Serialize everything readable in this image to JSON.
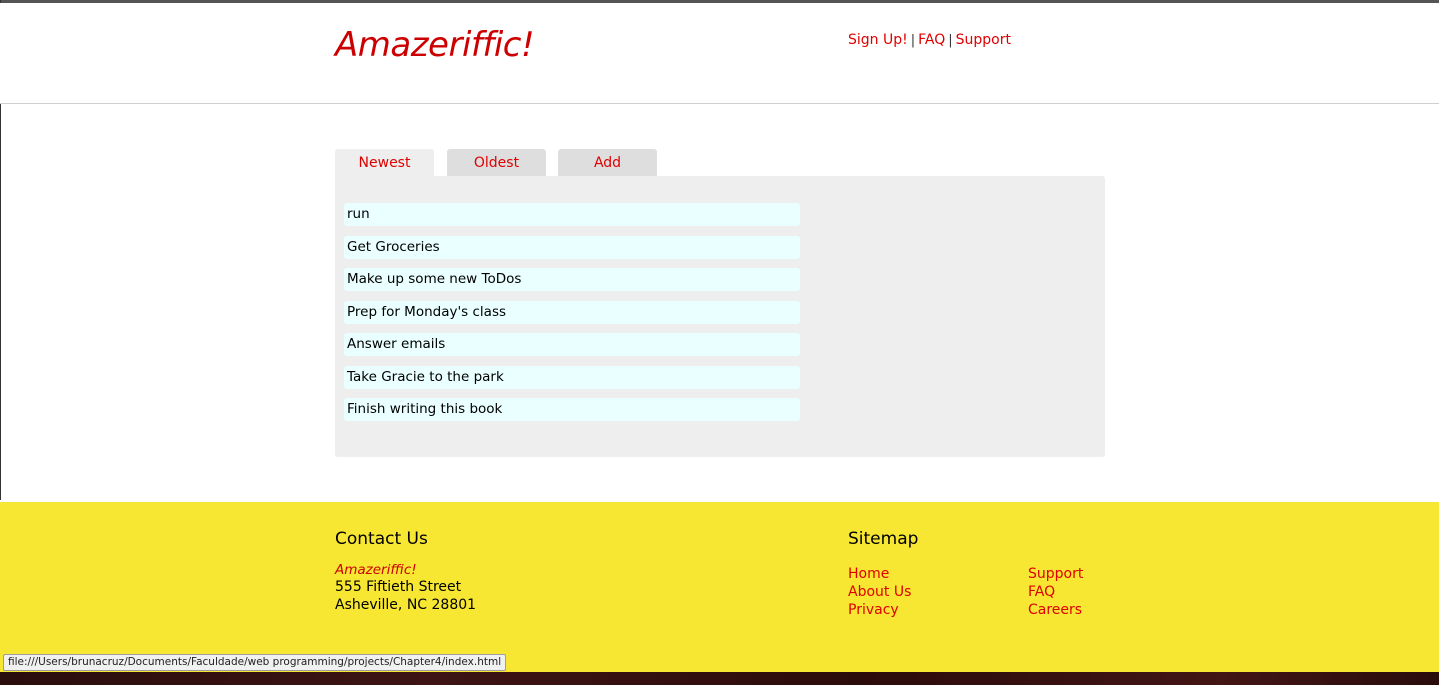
{
  "header": {
    "logo": "Amazeriffic!",
    "nav": [
      {
        "label": "Sign Up!"
      },
      {
        "label": "FAQ"
      },
      {
        "label": "Support"
      }
    ],
    "separator": "|"
  },
  "tabs": [
    {
      "label": "Newest",
      "active": true
    },
    {
      "label": "Oldest",
      "active": false
    },
    {
      "label": "Add",
      "active": false
    }
  ],
  "todos": [
    "run",
    "Get Groceries",
    "Make up some new ToDos",
    "Prep for Monday's class",
    "Answer emails",
    "Take Gracie to the park",
    "Finish writing this book"
  ],
  "footer": {
    "contact": {
      "title": "Contact Us",
      "company": "Amazeriffic!",
      "street": "555 Fiftieth Street",
      "city": "Asheville, NC 28801"
    },
    "sitemap": {
      "title": "Sitemap",
      "col1": [
        "Home",
        "About Us",
        "Privacy"
      ],
      "col2": [
        "Support",
        "FAQ",
        "Careers"
      ]
    }
  },
  "status_bar": {
    "url": "file:///Users/brunacruz/Documents/Faculdade/web programming/projects/Chapter4/index.html"
  },
  "colors": {
    "accent": "#e00000",
    "footer_bg": "#f7e733",
    "panel_bg": "#eeeeee",
    "item_bg": "#eaffff"
  }
}
